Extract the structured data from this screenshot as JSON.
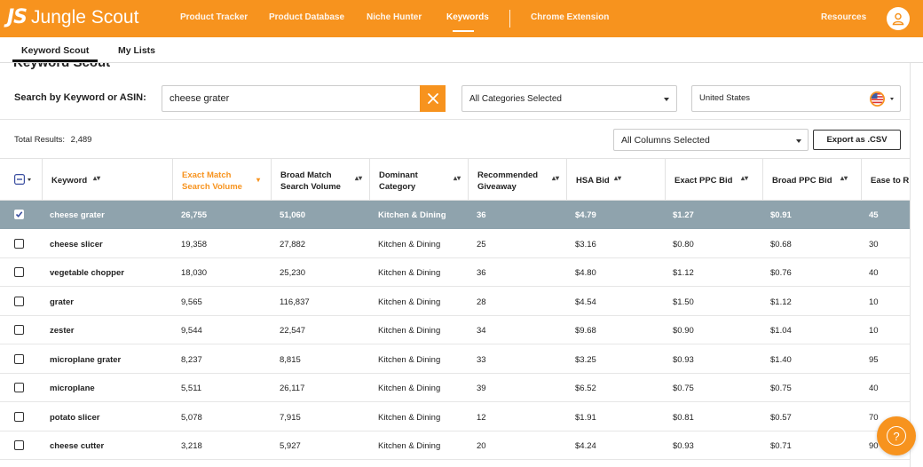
{
  "app": {
    "logo_mark": "JS",
    "logo_text": "Jungle Scout",
    "accent_color": "#f7931e"
  },
  "nav": {
    "items": [
      "Product Tracker",
      "Product Database",
      "Niche Hunter",
      "Keywords",
      "Chrome Extension"
    ],
    "active": "Keywords",
    "resources": "Resources"
  },
  "subtabs": {
    "items": [
      "Keyword Scout",
      "My Lists"
    ],
    "active": "Keyword Scout"
  },
  "page": {
    "title": "Keyword Scout"
  },
  "search": {
    "label": "Search by Keyword or ASIN:",
    "value": "cheese grater",
    "clear_icon": "close-icon"
  },
  "filters": {
    "category": "All Categories Selected",
    "marketplace": "United States",
    "flag_icon": "us-flag-icon",
    "columns": "All Columns Selected"
  },
  "results": {
    "label": "Total Results:",
    "count": "2,489",
    "export_label": "Export as .CSV"
  },
  "table": {
    "columns": [
      {
        "key": "keyword",
        "label": "Keyword",
        "sort": "both"
      },
      {
        "key": "exact",
        "label_1": "Exact Match",
        "label_2": "Search Volume",
        "sort": "desc"
      },
      {
        "key": "broad",
        "label_1": "Broad Match",
        "label_2": "Search Volume",
        "sort": "both"
      },
      {
        "key": "category",
        "label_1": "Dominant",
        "label_2": "Category",
        "sort": "both"
      },
      {
        "key": "giveaway",
        "label_1": "Recommended",
        "label_2": "Giveaway",
        "sort": "both"
      },
      {
        "key": "hsa",
        "label": "HSA Bid",
        "sort": "both"
      },
      {
        "key": "exact_ppc",
        "label": "Exact PPC Bid",
        "sort": "both"
      },
      {
        "key": "broad_ppc",
        "label": "Broad PPC Bid",
        "sort": "both"
      },
      {
        "key": "ease",
        "label": "Ease to R"
      }
    ],
    "rows": [
      {
        "keyword": "cheese grater",
        "exact": "26,755",
        "broad": "51,060",
        "category": "Kitchen & Dining",
        "giveaway": "36",
        "hsa": "$4.79",
        "exact_ppc": "$1.27",
        "broad_ppc": "$0.91",
        "ease": "45",
        "selected": true
      },
      {
        "keyword": "cheese slicer",
        "exact": "19,358",
        "broad": "27,882",
        "category": "Kitchen & Dining",
        "giveaway": "25",
        "hsa": "$3.16",
        "exact_ppc": "$0.80",
        "broad_ppc": "$0.68",
        "ease": "30",
        "selected": false
      },
      {
        "keyword": "vegetable chopper",
        "exact": "18,030",
        "broad": "25,230",
        "category": "Kitchen & Dining",
        "giveaway": "36",
        "hsa": "$4.80",
        "exact_ppc": "$1.12",
        "broad_ppc": "$0.76",
        "ease": "40",
        "selected": false
      },
      {
        "keyword": "grater",
        "exact": "9,565",
        "broad": "116,837",
        "category": "Kitchen & Dining",
        "giveaway": "28",
        "hsa": "$4.54",
        "exact_ppc": "$1.50",
        "broad_ppc": "$1.12",
        "ease": "10",
        "selected": false
      },
      {
        "keyword": "zester",
        "exact": "9,544",
        "broad": "22,547",
        "category": "Kitchen & Dining",
        "giveaway": "34",
        "hsa": "$9.68",
        "exact_ppc": "$0.90",
        "broad_ppc": "$1.04",
        "ease": "10",
        "selected": false
      },
      {
        "keyword": "microplane grater",
        "exact": "8,237",
        "broad": "8,815",
        "category": "Kitchen & Dining",
        "giveaway": "33",
        "hsa": "$3.25",
        "exact_ppc": "$0.93",
        "broad_ppc": "$1.40",
        "ease": "95",
        "selected": false
      },
      {
        "keyword": "microplane",
        "exact": "5,511",
        "broad": "26,117",
        "category": "Kitchen & Dining",
        "giveaway": "39",
        "hsa": "$6.52",
        "exact_ppc": "$0.75",
        "broad_ppc": "$0.75",
        "ease": "40",
        "selected": false
      },
      {
        "keyword": "potato slicer",
        "exact": "5,078",
        "broad": "7,915",
        "category": "Kitchen & Dining",
        "giveaway": "12",
        "hsa": "$1.91",
        "exact_ppc": "$0.81",
        "broad_ppc": "$0.57",
        "ease": "70",
        "selected": false
      },
      {
        "keyword": "cheese cutter",
        "exact": "3,218",
        "broad": "5,927",
        "category": "Kitchen & Dining",
        "giveaway": "20",
        "hsa": "$4.24",
        "exact_ppc": "$0.93",
        "broad_ppc": "$0.71",
        "ease": "90",
        "selected": false
      }
    ]
  },
  "help": {
    "icon": "help-icon",
    "glyph": "?"
  }
}
